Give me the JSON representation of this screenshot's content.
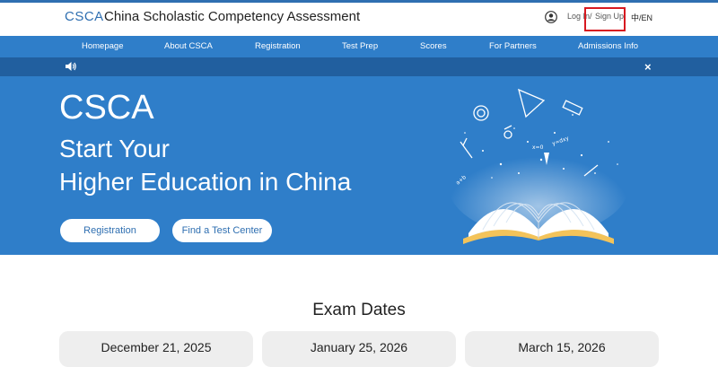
{
  "header": {
    "logo": "CSCA",
    "site_name": "China Scholastic Competency Assessment",
    "login": "Log In",
    "slash": "/",
    "signup": "Sign Up",
    "language": "中/EN",
    "user_icon": "user-icon"
  },
  "nav": {
    "items": [
      "Homepage",
      "About CSCA",
      "Registration",
      "Test Prep",
      "Scores",
      "For Partners",
      "Admissions Info"
    ]
  },
  "notice": {
    "speaker_icon": "speaker-icon",
    "close_icon": "close-icon",
    "close_symbol": "×"
  },
  "hero": {
    "title": "CSCA",
    "subtitle_line1": "Start Your",
    "subtitle_line2": "Higher Education in China",
    "buttons": [
      "Registration",
      "Find a Test Center"
    ]
  },
  "exam_dates": {
    "title": "Exam Dates",
    "dates": [
      "December 21, 2025",
      "January 25, 2026",
      "March 15, 2026"
    ]
  },
  "colors": {
    "brand_blue": "#2f7ec9",
    "dark_blue": "#215f9f",
    "highlight_red": "#d71920"
  }
}
